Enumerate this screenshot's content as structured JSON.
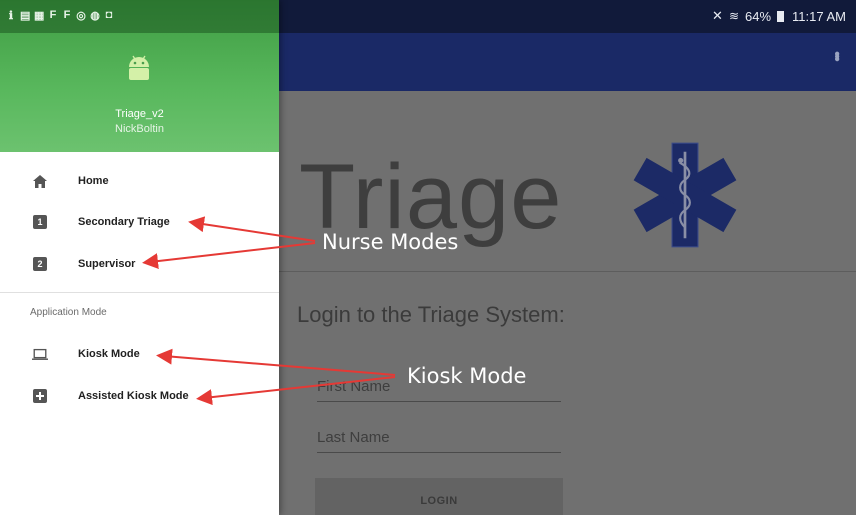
{
  "status_bar": {
    "left_icons": [
      "ℹ",
      "▤",
      "▦",
      "F",
      "F",
      "◎",
      "◍",
      "◘"
    ],
    "battery": "64%",
    "time": "11:17 AM"
  },
  "drawer": {
    "header": {
      "app_name": "Triage_v2",
      "user": "NickBoltin",
      "color": "#4caf50"
    },
    "items": [
      {
        "label": "Home",
        "icon": "home-icon"
      },
      {
        "label": "Secondary Triage",
        "icon": "looks-one-icon",
        "badge": "1"
      },
      {
        "label": "Supervisor",
        "icon": "looks-two-icon",
        "badge": "2"
      }
    ],
    "section_label": "Application Mode",
    "mode_items": [
      {
        "label": "Kiosk Mode",
        "icon": "laptop-icon"
      },
      {
        "label": "Assisted Kiosk Mode",
        "icon": "add-box-icon"
      }
    ]
  },
  "main": {
    "title": "Triage",
    "login_heading": "Login to the Triage System:",
    "first_name_placeholder": "First Name",
    "last_name_placeholder": "Last Name",
    "login_button": "LOGIN",
    "toolbar_color": "#1a2966",
    "emblem": "star-of-life-icon"
  },
  "annotations": {
    "nurse_modes": "Nurse Modes",
    "kiosk_mode": "Kiosk Mode",
    "arrow_color": "#e53935"
  }
}
